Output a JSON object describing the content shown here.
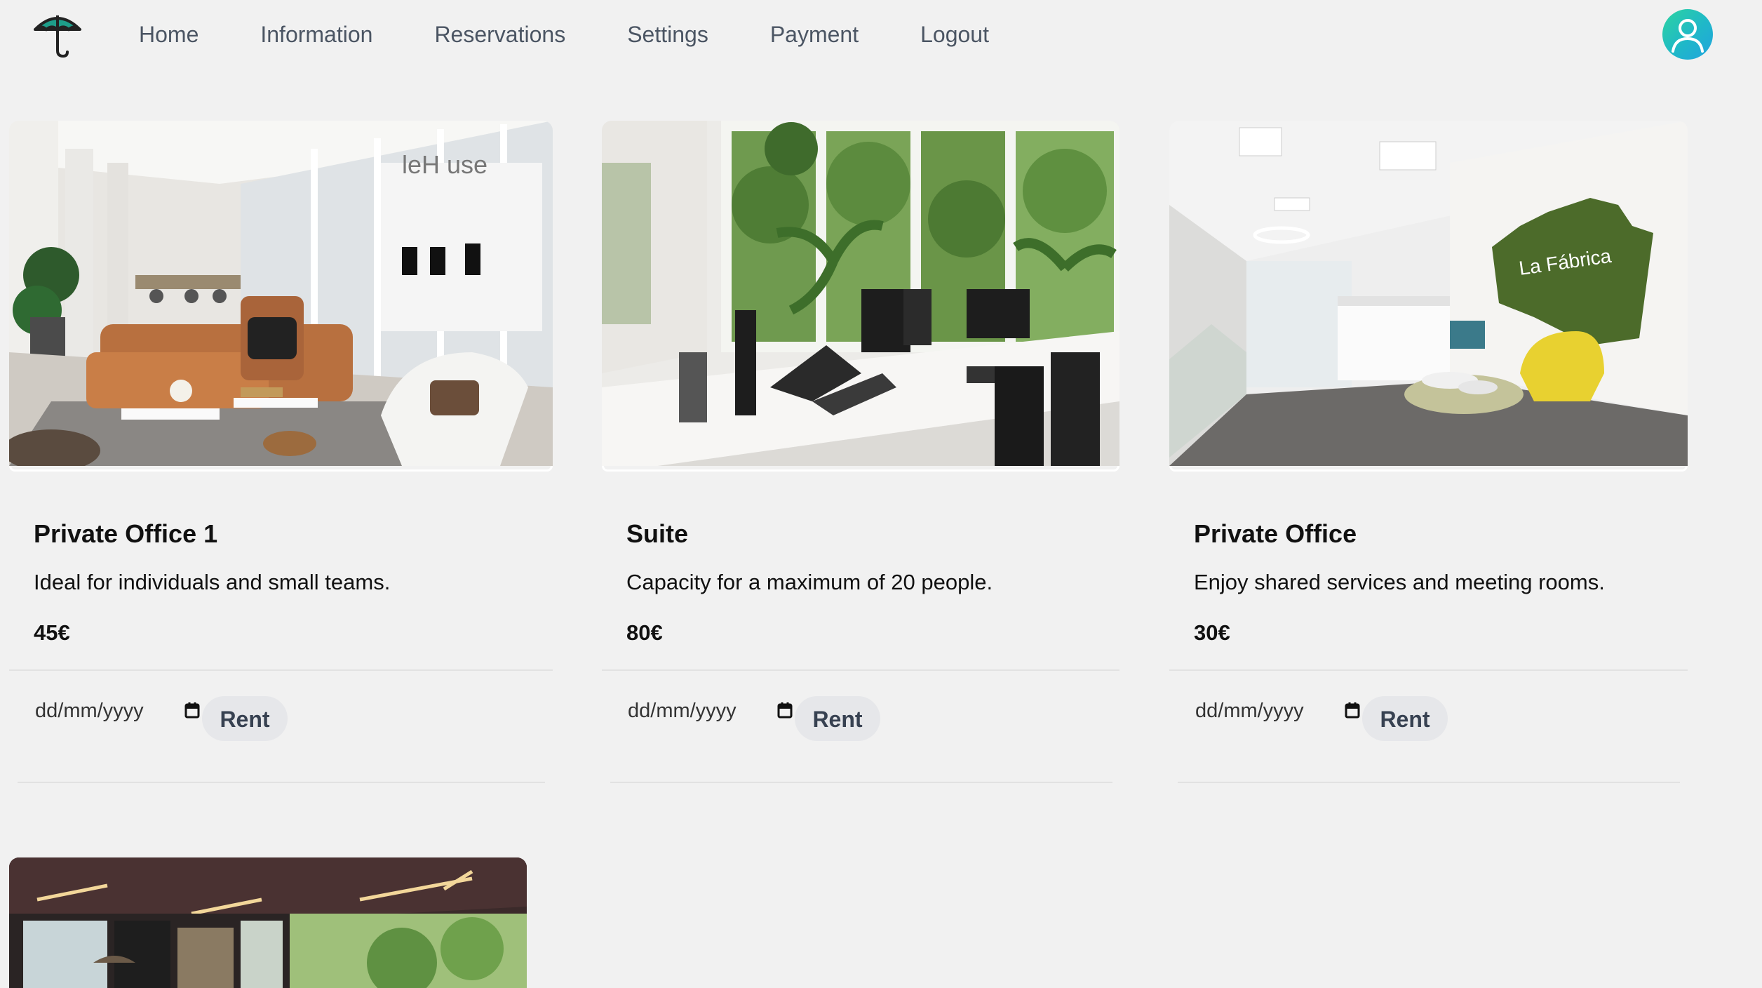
{
  "nav": {
    "logo": "umbrella-icon",
    "links": [
      {
        "label": "Home"
      },
      {
        "label": "Information"
      },
      {
        "label": "Reservations"
      },
      {
        "label": "Settings"
      },
      {
        "label": "Payment"
      },
      {
        "label": "Logout"
      }
    ],
    "avatar": "user-icon"
  },
  "cards": [
    {
      "title": "Private Office 1",
      "description": "Ideal for individuals and small teams.",
      "price": "45€",
      "date_placeholder": "dd/mm/yyyy",
      "button_label": "Rent",
      "image_sign_text": "leH   use"
    },
    {
      "title": "Suite",
      "description": "Capacity for a maximum of 20 people.",
      "price": "80€",
      "date_placeholder": "dd/mm/yyyy",
      "button_label": "Rent"
    },
    {
      "title": "Private Office",
      "description": "Enjoy shared services and meeting rooms.",
      "price": "30€",
      "date_placeholder": "dd/mm/yyyy",
      "button_label": "Rent",
      "image_wall_text": "La Fábrica"
    }
  ],
  "colors": {
    "background": "#f1f1f1",
    "nav_text": "#4b5563",
    "button_bg": "#e6e7ea",
    "avatar_gradient_start": "#2dd4a0",
    "avatar_gradient_end": "#22a4de",
    "logo_teal": "#1e9e8a"
  }
}
